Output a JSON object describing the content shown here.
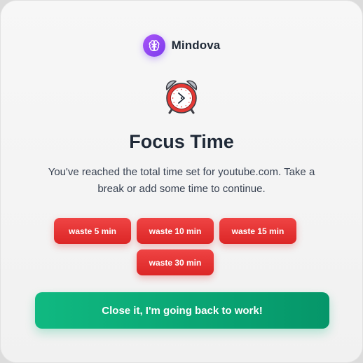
{
  "brand": {
    "name": "Mindova",
    "icon": "brain-icon",
    "accent": "#8b5cf6"
  },
  "hero": {
    "icon": "alarm-clock-icon"
  },
  "title": "Focus Time",
  "message": "You've reached the total time set for youtube.com. Take a break or add some time to continue.",
  "waste_buttons": [
    {
      "label": "waste 5 min"
    },
    {
      "label": "waste 10 min"
    },
    {
      "label": "waste 15 min"
    },
    {
      "label": "waste 30 min"
    }
  ],
  "close_button": {
    "label": "Close it, I'm going back to work!"
  },
  "colors": {
    "waste": "#ef4444",
    "close": "#10b981",
    "text": "#1f2937"
  }
}
